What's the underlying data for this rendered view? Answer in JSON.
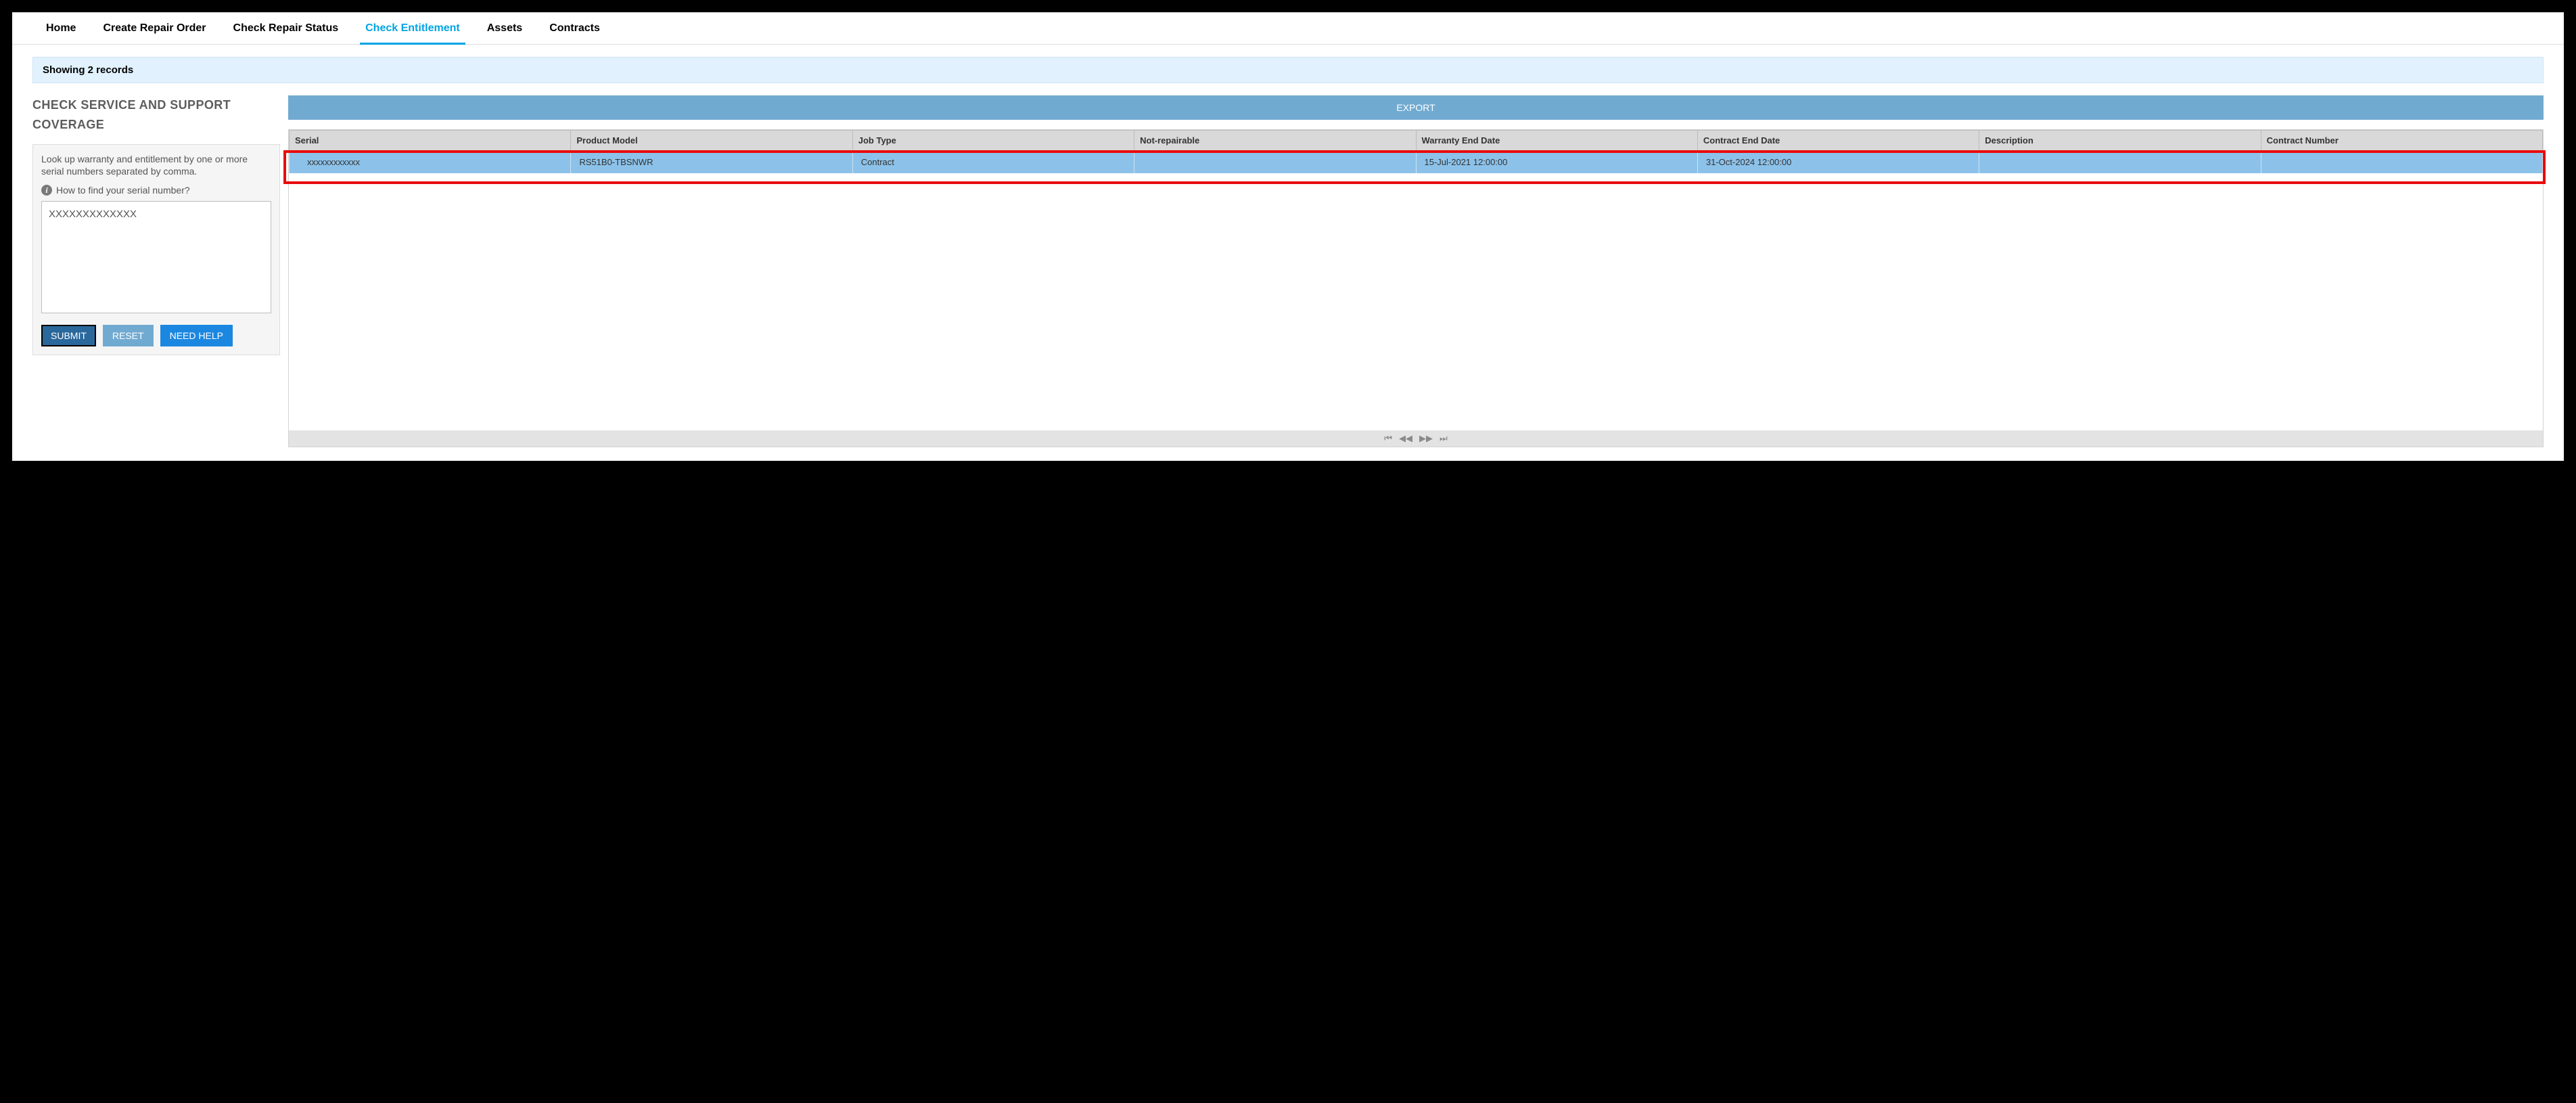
{
  "nav": {
    "tabs": [
      {
        "label": "Home"
      },
      {
        "label": "Create Repair Order"
      },
      {
        "label": "Check Repair Status"
      },
      {
        "label": "Check Entitlement",
        "active": true
      },
      {
        "label": "Assets"
      },
      {
        "label": "Contracts"
      }
    ]
  },
  "records_bar": "Showing 2 records",
  "left": {
    "heading_line1": "CHECK SERVICE AND SUPPORT",
    "heading_line2": "COVERAGE",
    "desc": "Look up warranty and entitlement by one or more serial numbers separated by comma.",
    "hint": "How to find your serial number?",
    "textarea_value": "XXXXXXXXXXXXX",
    "submit": "SUBMIT",
    "reset": "RESET",
    "need_help": "NEED HELP"
  },
  "right": {
    "export": "EXPORT",
    "columns": [
      "Serial",
      "Product Model",
      "Job Type",
      "Not-repairable",
      "Warranty End Date",
      "Contract End Date",
      "Description",
      "Contract Number"
    ],
    "rows": [
      {
        "serial": "xxxxxxxxxxxx",
        "product_model": "RS51B0-TBSNWR",
        "job_type": "Contract",
        "not_repairable": "",
        "warranty_end": "15-Jul-2021 12:00:00",
        "contract_end": "31-Oct-2024 12:00:00",
        "description": "",
        "contract_number": ""
      }
    ]
  }
}
